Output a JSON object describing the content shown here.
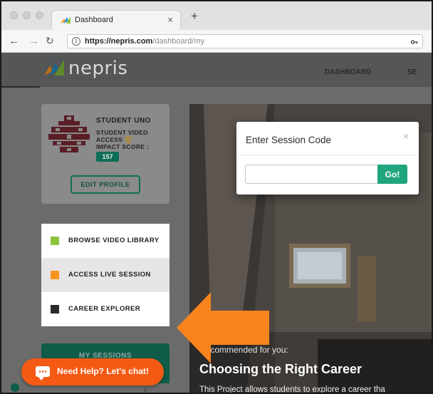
{
  "browser": {
    "tab_title": "Dashboard",
    "tab_close": "×",
    "new_tab": "+",
    "url_host": "https://nepris.com",
    "url_path": "/dashboard/my",
    "info_icon_glyph": "i"
  },
  "header": {
    "logo_text": "nepris",
    "links": [
      "DASHBOARD",
      "SE"
    ]
  },
  "profile": {
    "name": "STUDENT UNO",
    "video_access": "STUDENT VIDEO ACCESS",
    "impact_score_label": "IMPACT SCORE :",
    "impact_score": "157",
    "edit_button": "EDIT PROFILE"
  },
  "menu": {
    "items": [
      {
        "label": "BROWSE VIDEO LIBRARY",
        "color": "#8dc43e"
      },
      {
        "label": "ACCESS LIVE SESSION",
        "color": "#f7941d"
      },
      {
        "label": "CAREER EXPLORER",
        "color": "#2b2b2b"
      }
    ],
    "active_index": 1
  },
  "sessions": {
    "title": "MY SESSIONS"
  },
  "video": {
    "recommended_label": "Recommended for you:",
    "title": "Choosing the Right Career",
    "description": "This Project allows students to explore a career tha"
  },
  "modal": {
    "title": "Enter Session Code",
    "close": "×",
    "input_value": "",
    "input_placeholder": "",
    "go_label": "Go!"
  },
  "help": {
    "label": "Need Help? Let's chat!"
  },
  "colors": {
    "accent_green": "#20a57e",
    "dark_green": "#0f6e57",
    "orange": "#f45a14",
    "arrow_orange": "#f7941d"
  }
}
